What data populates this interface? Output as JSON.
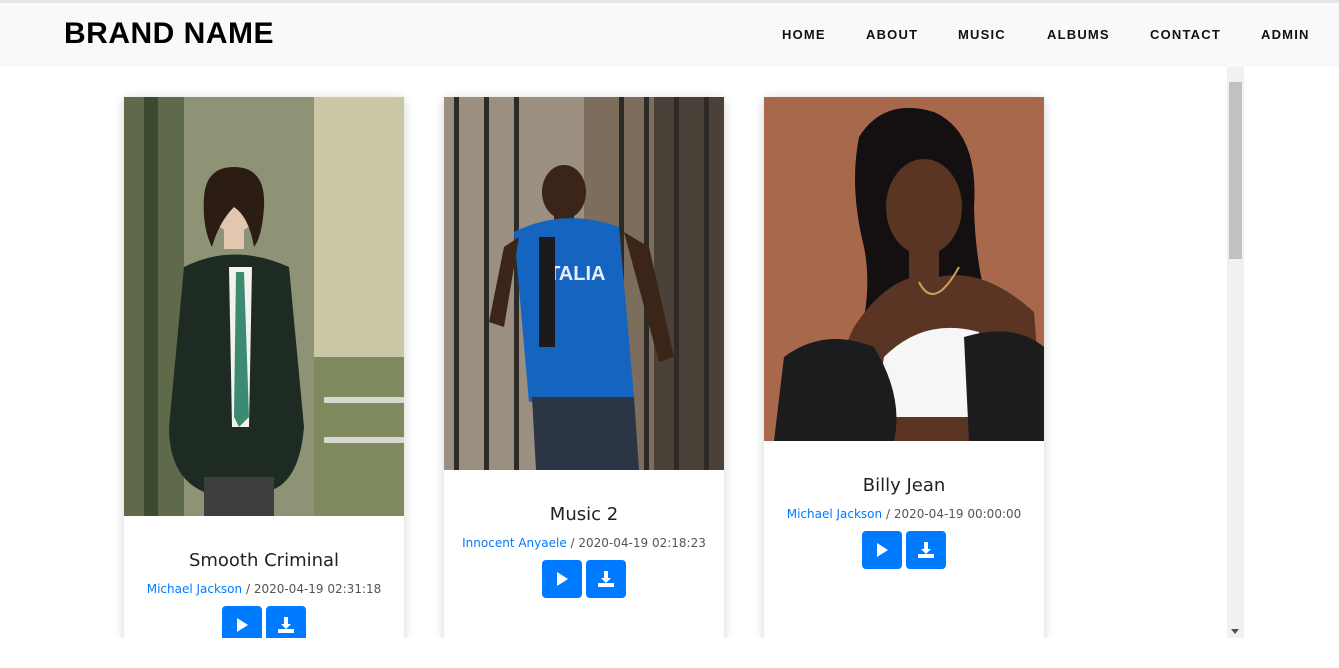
{
  "navbar": {
    "brand": "BRAND NAME",
    "items": [
      {
        "label": "HOME"
      },
      {
        "label": "ABOUT"
      },
      {
        "label": "MUSIC"
      },
      {
        "label": "ALBUMS"
      },
      {
        "label": "CONTACT"
      },
      {
        "label": "ADMIN"
      }
    ]
  },
  "songs": [
    {
      "title": "Smooth Criminal",
      "artist": "Michael Jackson",
      "separator": " / ",
      "date": "2020-04-19 02:31:18"
    },
    {
      "title": "Music 2",
      "artist": "Innocent Anyaele",
      "separator": " / ",
      "date": "2020-04-19 02:18:23"
    },
    {
      "title": "Billy Jean",
      "artist": "Michael Jackson",
      "separator": " / ",
      "date": "2020-04-19 00:00:00"
    }
  ],
  "icons": {
    "play": "play-icon",
    "download": "download-icon"
  },
  "colors": {
    "accent": "#007bff",
    "navbar_bg": "#f8f9fa",
    "link": "#007bff"
  }
}
